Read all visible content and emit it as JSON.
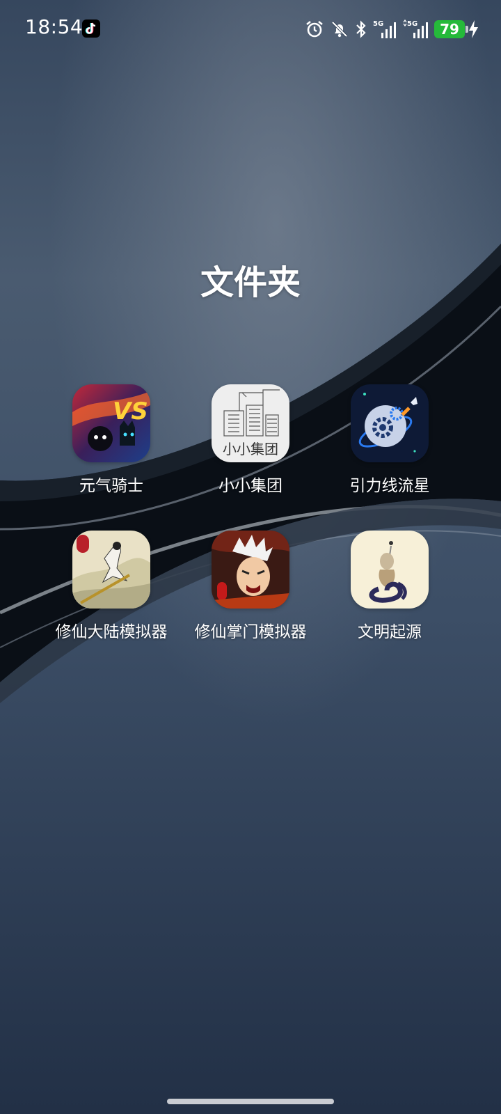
{
  "status_bar": {
    "time": "18:54",
    "notification_icons": [
      "tiktok-icon"
    ],
    "indicators": [
      "alarm-icon",
      "mute-icon",
      "bluetooth-icon",
      "signal-5g-icon",
      "signal-5g-icon"
    ],
    "network_1": "5G",
    "network_2": "5G",
    "battery_level": "79",
    "charging": true,
    "battery_color": "#25b93a"
  },
  "folder": {
    "title": "文件夹",
    "apps": [
      {
        "label": "元气骑士",
        "icon": "soul-knight-icon"
      },
      {
        "label": "小小集团",
        "icon": "little-corp-icon",
        "icon_text": "小小集团"
      },
      {
        "label": "引力线流星",
        "icon": "gravity-meteor-icon"
      },
      {
        "label": "修仙大陆模拟器",
        "icon": "cultivation-continent-icon"
      },
      {
        "label": "修仙掌门模拟器",
        "icon": "cultivation-sect-icon"
      },
      {
        "label": "文明起源",
        "icon": "civilization-origin-icon"
      }
    ]
  }
}
